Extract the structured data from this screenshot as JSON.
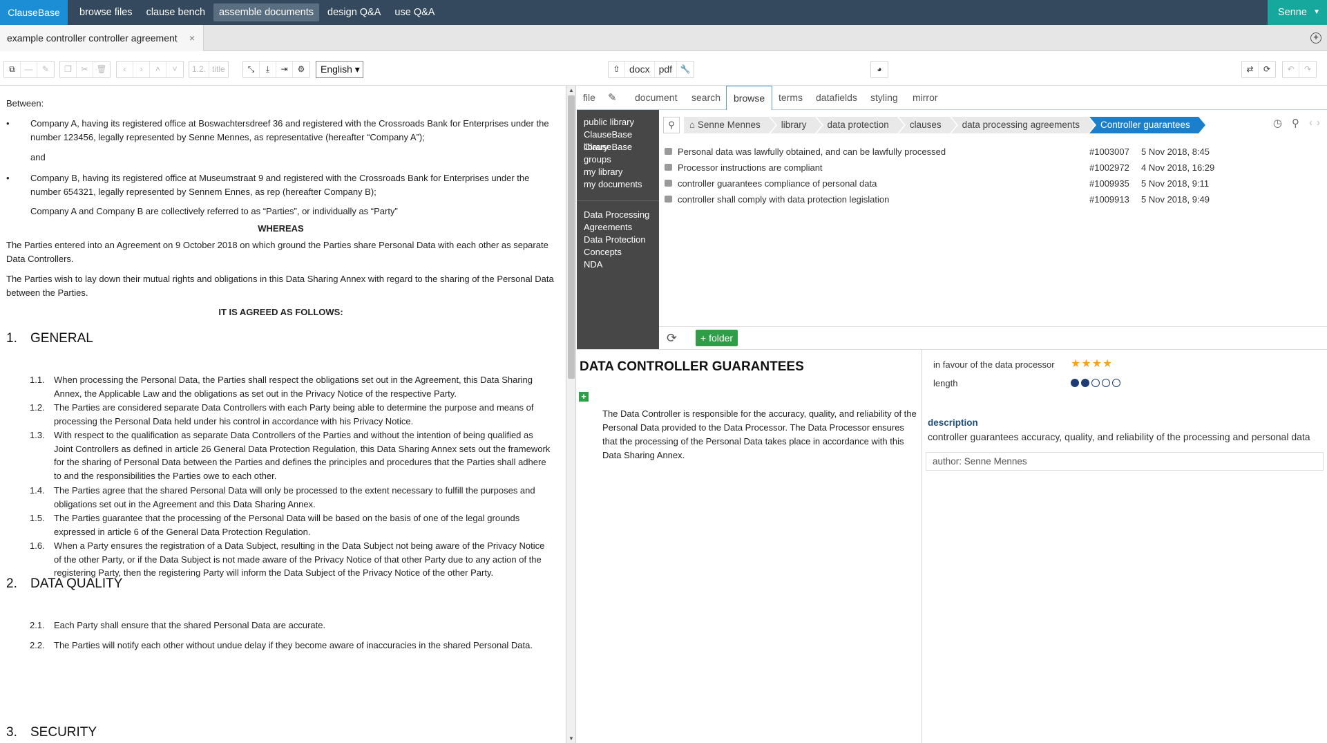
{
  "app": {
    "brand": "ClauseBase",
    "nav": [
      "browse files",
      "clause bench",
      "assemble documents",
      "design Q&A",
      "use Q&A"
    ],
    "active_nav": "assemble documents",
    "user": "Senne"
  },
  "tab": {
    "title": "example controller controller agreement",
    "close": "×"
  },
  "toolbar": {
    "heading_num": "1.2.",
    "heading_title": "title",
    "language": "English ▾",
    "docx": "docx",
    "pdf": "pdf"
  },
  "document": {
    "between": "Between:",
    "party_a": "Company A, having its registered office at Boswachtersdreef 36 and registered with the Crossroads Bank for Enterprises under the number 123456, legally represented by Senne Mennes, as representative (hereafter “Company A”);",
    "and": "and",
    "party_b": "Company B, having its registered office at Museumstraat 9 and registered with the Crossroads Bank for Enterprises under the number 654321, legally represented by Sennem Ennes, as rep (hereafter Company B);",
    "collective": "Company A and Company B are collectively referred to as “Parties”, or individually as “Party”",
    "whereas": "WHEREAS",
    "recital1": "The Parties entered into an Agreement on 9 October 2018 on which ground the Parties share Personal Data with each other as separate Data Controllers.",
    "recital2": "The Parties wish to lay down their mutual rights and obligations in this Data Sharing Annex with regard to the sharing of the Personal Data between the Parties.",
    "agreed": "IT IS AGREED AS FOLLOWS:",
    "sections": [
      {
        "num": "1.",
        "title": "GENERAL",
        "clauses": [
          {
            "num": "1.1.",
            "text": "When processing the Personal Data, the Parties shall respect the obligations set out in the Agreement, this Data Sharing Annex, the Applicable Law and the obligations as set out in the Privacy Notice of the respective Party."
          },
          {
            "num": "1.2.",
            "text": "The Parties are considered separate Data Controllers with each Party being able to determine the purpose and means of processing the Personal Data held under his control in accordance with his Privacy Notice."
          },
          {
            "num": "1.3.",
            "text": "With respect to the qualification as separate Data Controllers of the Parties and without the intention of being qualified as Joint Controllers as defined in article 26 General Data Protection Regulation, this Data Sharing Annex sets out the framework for the sharing of Personal Data between the Parties and defines the principles and procedures that the Parties shall adhere to and the responsibilities the Parties owe to each other."
          },
          {
            "num": "1.4.",
            "text": "The Parties agree that the shared Personal Data will only be processed to the extent necessary to fulfill the purposes and obligations set out in the Agreement and this Data Sharing Annex."
          },
          {
            "num": "1.5.",
            "text": "The Parties guarantee that the processing of the Personal Data will be based on the basis of one of the legal grounds expressed in article 6 of the General Data Protection Regulation."
          },
          {
            "num": "1.6.",
            "text": "When a Party ensures the registration of a Data Subject, resulting in the Data Subject not being aware of the Privacy Notice of the other Party, or if the Data Subject is not made aware of the Privacy Notice of that other Party due to any action of the registering Party, then the registering Party will inform the Data Subject of the Privacy Notice of the other Party."
          }
        ]
      },
      {
        "num": "2.",
        "title": "DATA QUALITY",
        "clauses": [
          {
            "num": "2.1.",
            "text": "Each Party shall ensure that the shared Personal Data are accurate."
          },
          {
            "num": "2.2.",
            "text": "The Parties will notify each other without undue delay if they become aware of inaccuracies in the shared Personal Data."
          }
        ]
      },
      {
        "num": "3.",
        "title": "SECURITY",
        "clauses": []
      }
    ]
  },
  "right_tabs": [
    "file",
    "document",
    "search",
    "browse",
    "terms",
    "datafields",
    "styling",
    "mirror"
  ],
  "active_right_tab": "browse",
  "sidebar": {
    "libraries": [
      "public library",
      "ClauseBase library",
      "ClauseBase groups",
      "my library",
      "my documents"
    ],
    "folders": [
      "Data Processing Agreements",
      "Data Protection Concepts",
      "NDA"
    ]
  },
  "breadcrumbs": [
    "Senne Mennes",
    "library",
    "data protection",
    "clauses",
    "data processing agreements",
    "Controller guarantees"
  ],
  "clauses": [
    {
      "title": "Personal data was lawfully obtained, and can be lawfully processed",
      "id": "#1003007",
      "date": "5 Nov 2018, 8:45"
    },
    {
      "title": "Processor instructions are compliant",
      "id": "#1002972",
      "date": "4 Nov 2018, 16:29"
    },
    {
      "title": "controller guarantees compliance of personal data",
      "id": "#1009935",
      "date": "5 Nov 2018, 9:11"
    },
    {
      "title": "controller shall comply with data protection legislation",
      "id": "#1009913",
      "date": "5 Nov 2018, 9:49"
    }
  ],
  "browser_footer": {
    "folder_button": "+ folder"
  },
  "detail": {
    "title": "DATA CONTROLLER GUARANTEES",
    "body": "The Data Controller is responsible for the accuracy, quality, and reliability of the Personal Data provided to the Data Processor. The Data Processor ensures that the processing of the Personal Data takes place in accordance with this Data Sharing Annex.",
    "favour_label": "in favour of the data processor",
    "favour_stars": 4,
    "length_label": "length",
    "length_level": 2,
    "length_max": 5,
    "description_label": "description",
    "description": "controller guarantees accuracy, quality, and reliability of the processing and personal data",
    "author": "author: Senne Mennes"
  }
}
